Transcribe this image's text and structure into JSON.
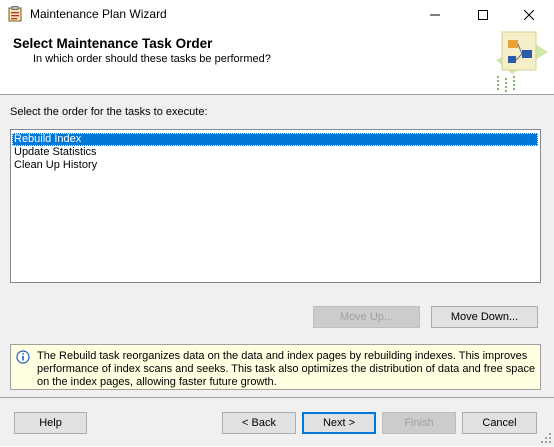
{
  "window": {
    "title": "Maintenance Plan Wizard"
  },
  "header": {
    "title": "Select Maintenance Task Order",
    "subtitle": "In which order should these tasks be performed?"
  },
  "task_order": {
    "label": "Select the order for the tasks to execute:",
    "items": [
      {
        "label": "Rebuild Index",
        "selected": true
      },
      {
        "label": "Update Statistics",
        "selected": false
      },
      {
        "label": "Clean Up History",
        "selected": false
      }
    ],
    "move_up_label": "Move Up...",
    "move_down_label": "Move Down..."
  },
  "info": {
    "text": "The Rebuild task reorganizes data on the data and index pages by rebuilding indexes. This improves performance of index scans and seeks. This task also optimizes the distribution of data and free space on the index pages, allowing faster future growth."
  },
  "footer": {
    "help_label": "Help",
    "back_label": "< Back",
    "next_label": "Next >",
    "finish_label": "Finish",
    "cancel_label": "Cancel"
  },
  "colors": {
    "selection": "#0078d7",
    "info_background": "#ffffe1",
    "dialog_background": "#f0f0f0"
  }
}
